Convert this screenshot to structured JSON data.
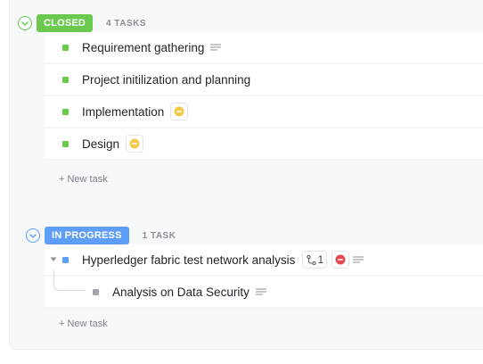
{
  "colors": {
    "closed": "#6bc950",
    "in_progress": "#5f9ef8",
    "priority_normal": "#f2c94c",
    "priority_urgent": "#e5484d",
    "subtask_square": "#a4a7ad"
  },
  "groups": [
    {
      "status": "CLOSED",
      "count": "4 TASKS",
      "tasks": [
        {
          "name": "Requirement gathering",
          "icons": [
            "description-icon"
          ]
        },
        {
          "name": "Project initilization and planning",
          "icons": []
        },
        {
          "name": "Implementation",
          "icons": [
            "priority-normal-icon"
          ]
        },
        {
          "name": "Design",
          "icons": [
            "priority-normal-icon"
          ]
        }
      ],
      "new_task": "+ New task"
    },
    {
      "status": "IN PROGRESS",
      "count": "1 TASK",
      "tasks": [
        {
          "name": "Hyperledger fabric test network analysis",
          "subtask_count": "1",
          "icons": [
            "subtask-icon",
            "priority-urgent-icon",
            "description-icon"
          ],
          "subtasks": [
            {
              "name": "Analysis on Data Security",
              "icons": [
                "description-icon"
              ]
            }
          ]
        }
      ],
      "new_task": "+ New task"
    }
  ]
}
